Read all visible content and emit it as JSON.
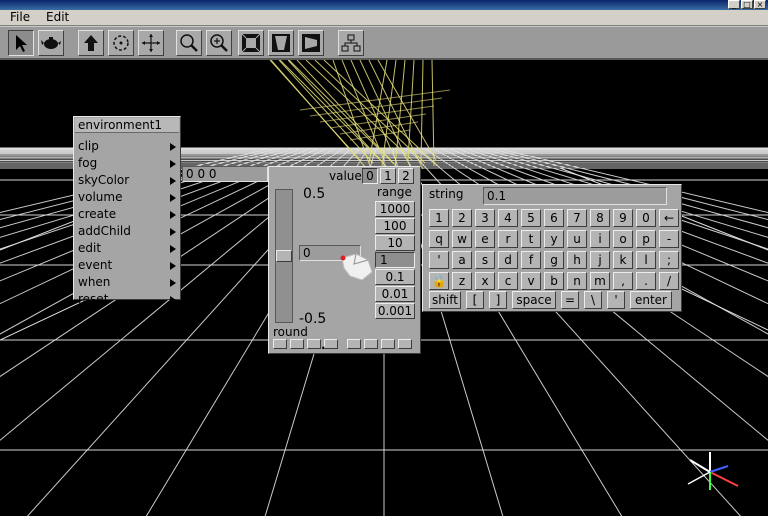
{
  "menubar": {
    "file": "File",
    "edit": "Edit"
  },
  "window_buttons": {
    "minimize": "_",
    "maximize": "□",
    "close": "×"
  },
  "toolbar": {
    "tools": [
      {
        "icon": "arrow-select-icon",
        "pressed": true
      },
      {
        "icon": "teapot-object-icon",
        "pressed": false
      },
      {
        "icon": "up-arrow-icon",
        "pressed": false
      },
      {
        "icon": "rotate-icon",
        "pressed": false
      },
      {
        "icon": "move-cross-icon",
        "pressed": false
      },
      {
        "icon": "zoom-icon",
        "pressed": false
      },
      {
        "icon": "zoom-in-icon",
        "pressed": false
      },
      {
        "icon": "view-front-icon",
        "pressed": false
      },
      {
        "icon": "view-perspective-icon",
        "pressed": false
      },
      {
        "icon": "view-side-icon",
        "pressed": false
      },
      {
        "icon": "hierarchy-icon",
        "pressed": false
      }
    ]
  },
  "env_menu": {
    "title": "environment1",
    "items": [
      "clip",
      "fog",
      "skyColor",
      "volume",
      "create",
      "addChild",
      "edit",
      "event",
      "when",
      "reset"
    ],
    "skycolor_value": "0 0 0"
  },
  "values_panel": {
    "label": "values",
    "tabs": [
      "0",
      "1",
      "2"
    ],
    "selected_tab": "0",
    "slider_max": "0.5",
    "slider_min": "-0.5",
    "current_value": "0",
    "slider_level": 0.5,
    "range_label": "range",
    "range_options": [
      "1000",
      "100",
      "10",
      "1",
      "0.1",
      "0.01",
      "0.001"
    ],
    "selected_range": "1",
    "round_label": "round",
    "round_decimal": "."
  },
  "string_panel": {
    "label": "string",
    "value": "0.1",
    "rows": [
      [
        "1",
        "2",
        "3",
        "4",
        "5",
        "6",
        "7",
        "8",
        "9",
        "0",
        "←"
      ],
      [
        "q",
        "w",
        "e",
        "r",
        "t",
        "y",
        "u",
        "i",
        "o",
        "p",
        "-"
      ],
      [
        "'",
        "a",
        "s",
        "d",
        "f",
        "g",
        "h",
        "j",
        "k",
        "l",
        ";"
      ],
      [
        "🔒",
        "z",
        "x",
        "c",
        "v",
        "b",
        "n",
        "m",
        ",",
        ".",
        "/"
      ],
      [
        "shift",
        "[",
        "]",
        "space",
        "=",
        "\\",
        "'",
        "enter"
      ]
    ]
  },
  "colors": {
    "panel": "#a5a5a5",
    "grid": "#e0e0e0",
    "ropes": "#e8e07a",
    "titlebar": "#0a246a"
  }
}
